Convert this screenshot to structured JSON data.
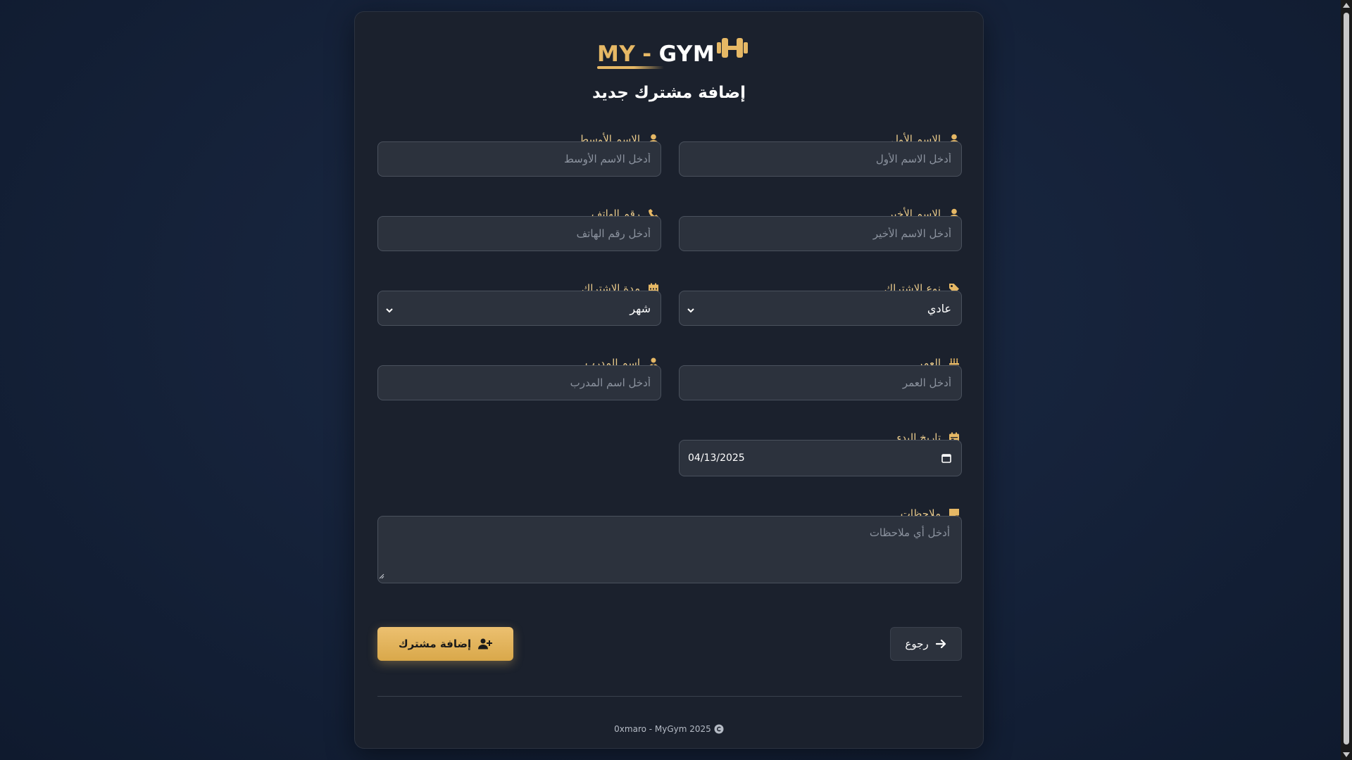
{
  "app": {
    "logo": {
      "my": "MY",
      "dash": "-",
      "gym": "GYM"
    },
    "page_title": "إضافة مشترك جديد"
  },
  "form": {
    "first_name": {
      "label": "الاسم الأول",
      "placeholder": "أدخل الاسم الأول",
      "icon": "user-icon"
    },
    "middle_name": {
      "label": "الاسم الأوسط",
      "placeholder": "أدخل الاسم الأوسط",
      "icon": "user-icon"
    },
    "last_name": {
      "label": "الاسم الأخير",
      "placeholder": "أدخل الاسم الأخير",
      "icon": "user-icon"
    },
    "phone": {
      "label": "رقم الهاتف",
      "placeholder": "أدخل رقم الهاتف",
      "icon": "phone-icon"
    },
    "subscription_type": {
      "label": "نوع الاشتراك",
      "value": "عادي",
      "icon": "tag-icon"
    },
    "subscription_duration": {
      "label": "مدة الاشتراك",
      "value": "شهر",
      "icon": "calendar-icon"
    },
    "age": {
      "label": "العمر",
      "placeholder": "أدخل العمر",
      "icon": "birthday-cake-icon"
    },
    "trainer_name": {
      "label": "اسم المدرب",
      "placeholder": "أدخل اسم المدرب",
      "icon": "trainer-icon"
    },
    "start_date": {
      "label": "تاريخ البدء",
      "value": "04/13/2025",
      "icon": "calendar-day-icon"
    },
    "notes": {
      "label": "ملاحظات",
      "placeholder": "أدخل أي ملاحظات",
      "icon": "sticky-note-icon"
    }
  },
  "actions": {
    "add_label": "إضافة مشترك",
    "back_label": "رجوع"
  },
  "footer": {
    "text": "0xmaro - MyGym 2025"
  },
  "colors": {
    "accent": "#e6b865",
    "card_bg": "#1b212d",
    "input_bg": "#2c323d",
    "page_bg": "#16233b"
  }
}
